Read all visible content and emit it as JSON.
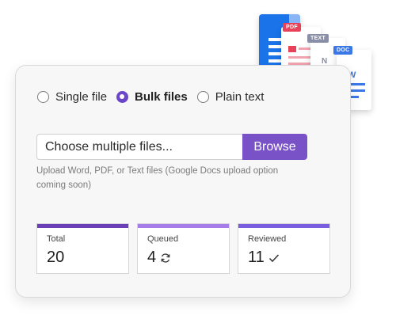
{
  "upload_modes": [
    {
      "label": "Single file",
      "selected": false
    },
    {
      "label": "Bulk files",
      "selected": true
    },
    {
      "label": "Plain text",
      "selected": false
    }
  ],
  "file_input": {
    "text": "Choose multiple files...",
    "browse_label": "Browse"
  },
  "hint": "Upload Word, PDF, or Text files (Google Docs upload option coming soon)",
  "stats": [
    {
      "label": "Total",
      "value": "20",
      "icon": "",
      "color": "#6b3fb5"
    },
    {
      "label": "Queued",
      "value": "4",
      "icon": "refresh-icon",
      "color": "#a67ce8"
    },
    {
      "label": "Reviewed",
      "value": "11",
      "icon": "check-icon",
      "color": "#7b5de0"
    }
  ],
  "doc_tags": {
    "pdf": "PDF",
    "text": "TEXT",
    "doc": "DOC"
  },
  "colors": {
    "accent": "#7a52c7",
    "google_docs_blue": "#1a73e8",
    "pdf_red": "#e8425a",
    "text_gray": "#8a8fa8",
    "doc_blue": "#3b78e7"
  }
}
